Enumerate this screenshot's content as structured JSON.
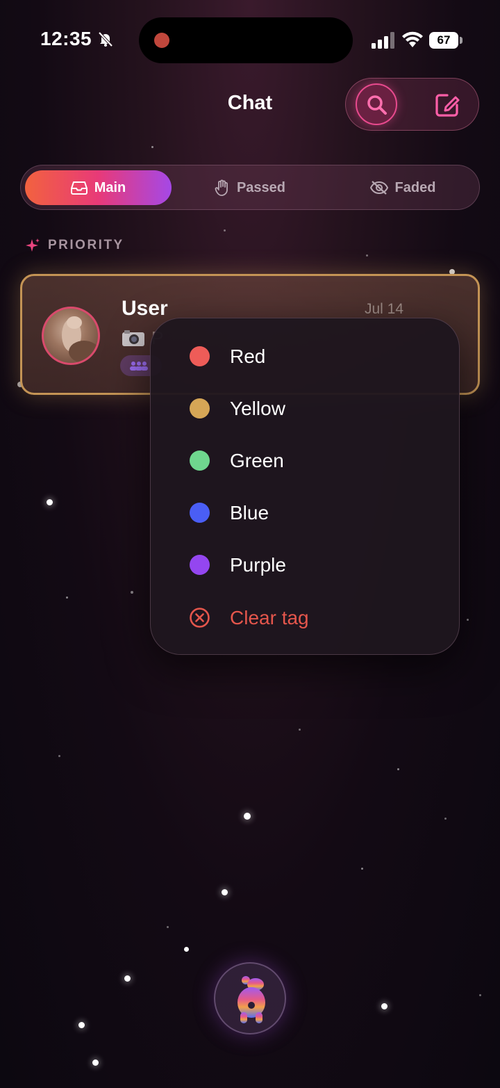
{
  "status_bar": {
    "time": "12:35",
    "battery": "67"
  },
  "header": {
    "title": "Chat"
  },
  "tabs": [
    {
      "label": "Main",
      "active": true
    },
    {
      "label": "Passed",
      "active": false
    },
    {
      "label": "Faded",
      "active": false
    }
  ],
  "section": {
    "label": "PRIORITY"
  },
  "chat": {
    "name": "User",
    "date": "Jul 14",
    "preview": "P"
  },
  "menu": {
    "items": [
      {
        "label": "Red",
        "color": "#ee5c58"
      },
      {
        "label": "Yellow",
        "color": "#d6a656"
      },
      {
        "label": "Green",
        "color": "#6fd68e"
      },
      {
        "label": "Blue",
        "color": "#4a5ef5"
      },
      {
        "label": "Purple",
        "color": "#9446f0"
      }
    ],
    "clear_label": "Clear tag",
    "clear_color": "#e5564c"
  },
  "colors": {
    "accent": "#e84a8e",
    "card_border": "#c49455"
  }
}
